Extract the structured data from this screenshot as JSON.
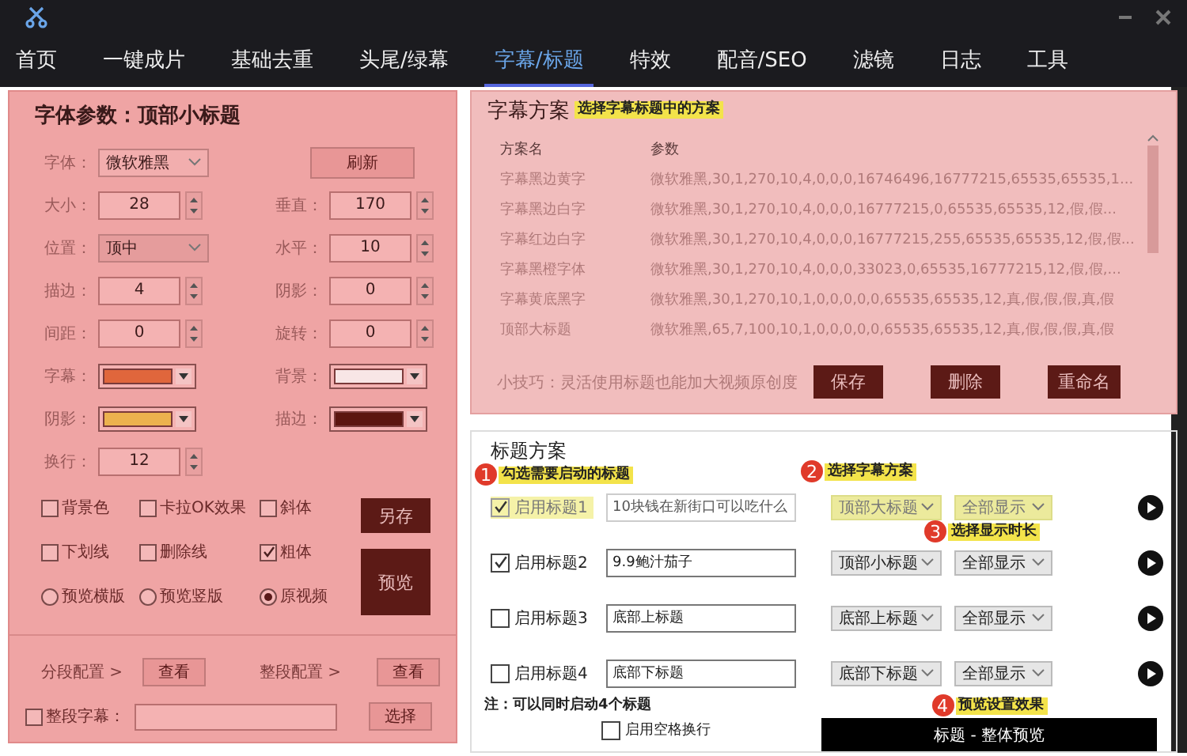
{
  "tabs": [
    {
      "label": "首页",
      "selected": false
    },
    {
      "label": "一键成片",
      "selected": false
    },
    {
      "label": "基础去重",
      "selected": false
    },
    {
      "label": "头尾/绿幕",
      "selected": false
    },
    {
      "label": "字幕/标题",
      "selected": true
    },
    {
      "label": "特效",
      "selected": false
    },
    {
      "label": "配音/SEO",
      "selected": false
    },
    {
      "label": "滤镜",
      "selected": false
    },
    {
      "label": "日志",
      "selected": false
    },
    {
      "label": "工具",
      "selected": false
    }
  ],
  "font_panel": {
    "title": "字体参数：顶部小标题",
    "rows": [
      {
        "left": {
          "kind": "select",
          "label": "字体：",
          "value": "微软雅黑"
        },
        "right": {
          "kind": "button",
          "text": "刷新"
        }
      },
      {
        "left": {
          "kind": "spin",
          "label": "大小：",
          "value": "28"
        },
        "right": {
          "kind": "spin",
          "label": "垂直：",
          "value": "170"
        }
      },
      {
        "left": {
          "kind": "select",
          "label": "位置：",
          "value": "顶中"
        },
        "right": {
          "kind": "spin",
          "label": "水平：",
          "value": "10"
        }
      },
      {
        "left": {
          "kind": "spin",
          "label": "描边：",
          "value": "4"
        },
        "right": {
          "kind": "spin",
          "label": "阴影：",
          "value": "0"
        }
      },
      {
        "left": {
          "kind": "spin",
          "label": "间距：",
          "value": "0"
        },
        "right": {
          "kind": "spin",
          "label": "旋转：",
          "value": "0"
        }
      },
      {
        "left": {
          "kind": "color",
          "label": "字幕：",
          "color": "#e0663c"
        },
        "right": {
          "kind": "color",
          "label": "背景：",
          "color": "#f8e6e6"
        }
      },
      {
        "left": {
          "kind": "color",
          "label": "阴影：",
          "color": "#ecb24e"
        },
        "right": {
          "kind": "color",
          "label": "描边：",
          "color": "#5c1610"
        }
      },
      {
        "left": {
          "kind": "spin",
          "label": "换行：",
          "value": "12"
        }
      }
    ],
    "checkboxes": [
      {
        "label": "背景色",
        "checked": false
      },
      {
        "label": "卡拉OK效果",
        "checked": false
      },
      {
        "label": "斜体",
        "checked": false
      },
      {
        "label": "下划线",
        "checked": false
      },
      {
        "label": "删除线",
        "checked": false
      },
      {
        "label": "粗体",
        "checked": true
      }
    ],
    "radios": [
      {
        "label": "预览横版",
        "selected": false
      },
      {
        "label": "预览竖版",
        "selected": false
      },
      {
        "label": "原视频",
        "selected": true
      }
    ],
    "save_as_button": "另存",
    "preview_button": "预览",
    "segment_config": {
      "label": "分段配置 >",
      "button": "查看"
    },
    "whole_config": {
      "label": "整段配置 >",
      "button": "查看"
    },
    "whole_subtitle": {
      "label": "整段字幕：",
      "checked": false,
      "button": "选择"
    }
  },
  "subtitle_scheme": {
    "title": "字幕方案",
    "annotation": "选择字幕标题中的方案",
    "columns": [
      "方案名",
      "参数"
    ],
    "rows": [
      [
        "字幕黑边黄字",
        "微软雅黑,30,1,270,10,4,0,0,0,16746496,16777215,65535,65535,1..."
      ],
      [
        "字幕黑边白字",
        "微软雅黑,30,1,270,10,4,0,0,0,16777215,0,65535,65535,12,假,假..."
      ],
      [
        "字幕红边白字",
        "微软雅黑,30,1,270,10,4,0,0,0,16777215,255,65535,65535,12,假,假..."
      ],
      [
        "字幕黑橙字体",
        "微软雅黑,30,1,270,10,4,0,0,0,33023,0,65535,16777215,12,假,假,..."
      ],
      [
        "字幕黄底黑字",
        "微软雅黑,30,1,270,10,1,0,0,0,0,0,65535,65535,12,真,假,假,假,真,假"
      ],
      [
        "顶部大标题",
        "微软雅黑,65,7,100,10,1,0,0,0,0,0,65535,65535,12,真,假,假,假,真,假"
      ]
    ],
    "tip": "小技巧：灵活使用标题也能加大视频原创度",
    "buttons": [
      "保存",
      "删除",
      "重命名"
    ]
  },
  "title_scheme": {
    "title": "标题方案",
    "rows": [
      {
        "checked": true,
        "label": "启用标题1",
        "value": "10块钱在新街口可以吃什么",
        "scheme": "顶部大标题",
        "duration": "全部显示",
        "highlighted": true
      },
      {
        "checked": true,
        "label": "启用标题2",
        "value": "9.9鲍汁茄子",
        "scheme": "顶部小标题",
        "duration": "全部显示",
        "highlighted": false
      },
      {
        "checked": false,
        "label": "启用标题3",
        "value": "底部上标题",
        "scheme": "底部上标题",
        "duration": "全部显示",
        "highlighted": false
      },
      {
        "checked": false,
        "label": "启用标题4",
        "value": "底部下标题",
        "scheme": "底部下标题",
        "duration": "全部显示",
        "highlighted": false
      }
    ],
    "annotations": [
      {
        "number": "1",
        "text": "勾选需要启动的标题"
      },
      {
        "number": "2",
        "text": "选择字幕方案"
      },
      {
        "number": "3",
        "text": "选择显示时长"
      },
      {
        "number": "4",
        "text": "预览设置效果"
      }
    ],
    "note": "注：可以同时启动4个标题",
    "space_wrap": {
      "label": "启用空格换行",
      "checked": false
    },
    "preview_button": "标题 - 整体预览"
  }
}
